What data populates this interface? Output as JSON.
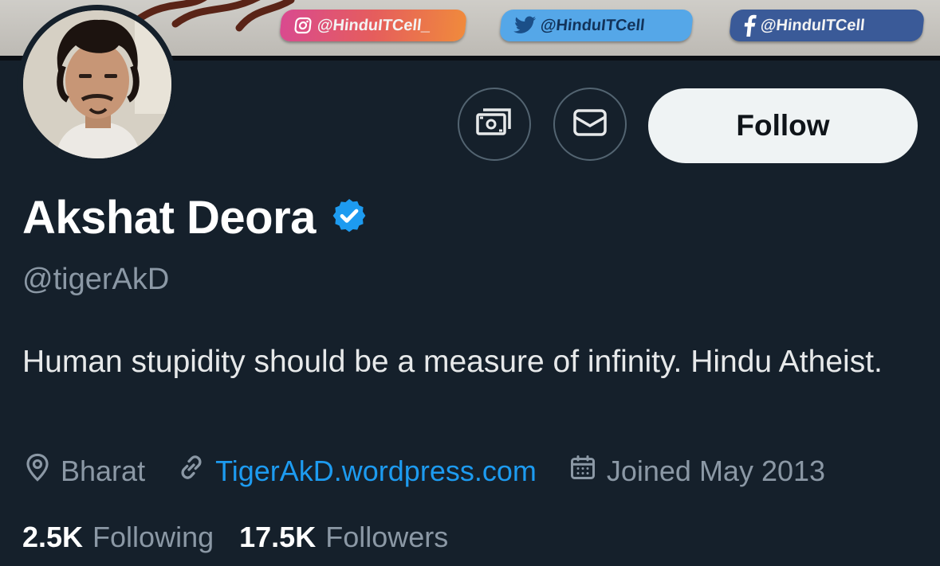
{
  "banner": {
    "instagram_label": "@HinduITCell_",
    "twitter_label": "@HinduITCell",
    "facebook_label": "@HinduITCell"
  },
  "actions": {
    "follow_label": "Follow"
  },
  "profile": {
    "display_name": "Akshat Deora",
    "handle": "@tigerAkD",
    "bio": "Human stupidity should be a measure of infinity. Hindu Atheist.",
    "location": "Bharat",
    "website": "TigerAkD.wordpress.com",
    "joined": "Joined May 2013"
  },
  "stats": {
    "following_count": "2.5K",
    "following_label": "Following",
    "followers_count": "17.5K",
    "followers_label": "Followers"
  },
  "colors": {
    "background": "#15202b",
    "verified_badge": "#1d9bf0",
    "link": "#1d9bf0",
    "secondary_text": "#8b98a5"
  },
  "icons": [
    "subscribe-icon",
    "message-icon",
    "verified-badge-icon",
    "location-icon",
    "link-icon",
    "calendar-icon",
    "instagram-icon",
    "twitter-icon",
    "facebook-icon"
  ]
}
